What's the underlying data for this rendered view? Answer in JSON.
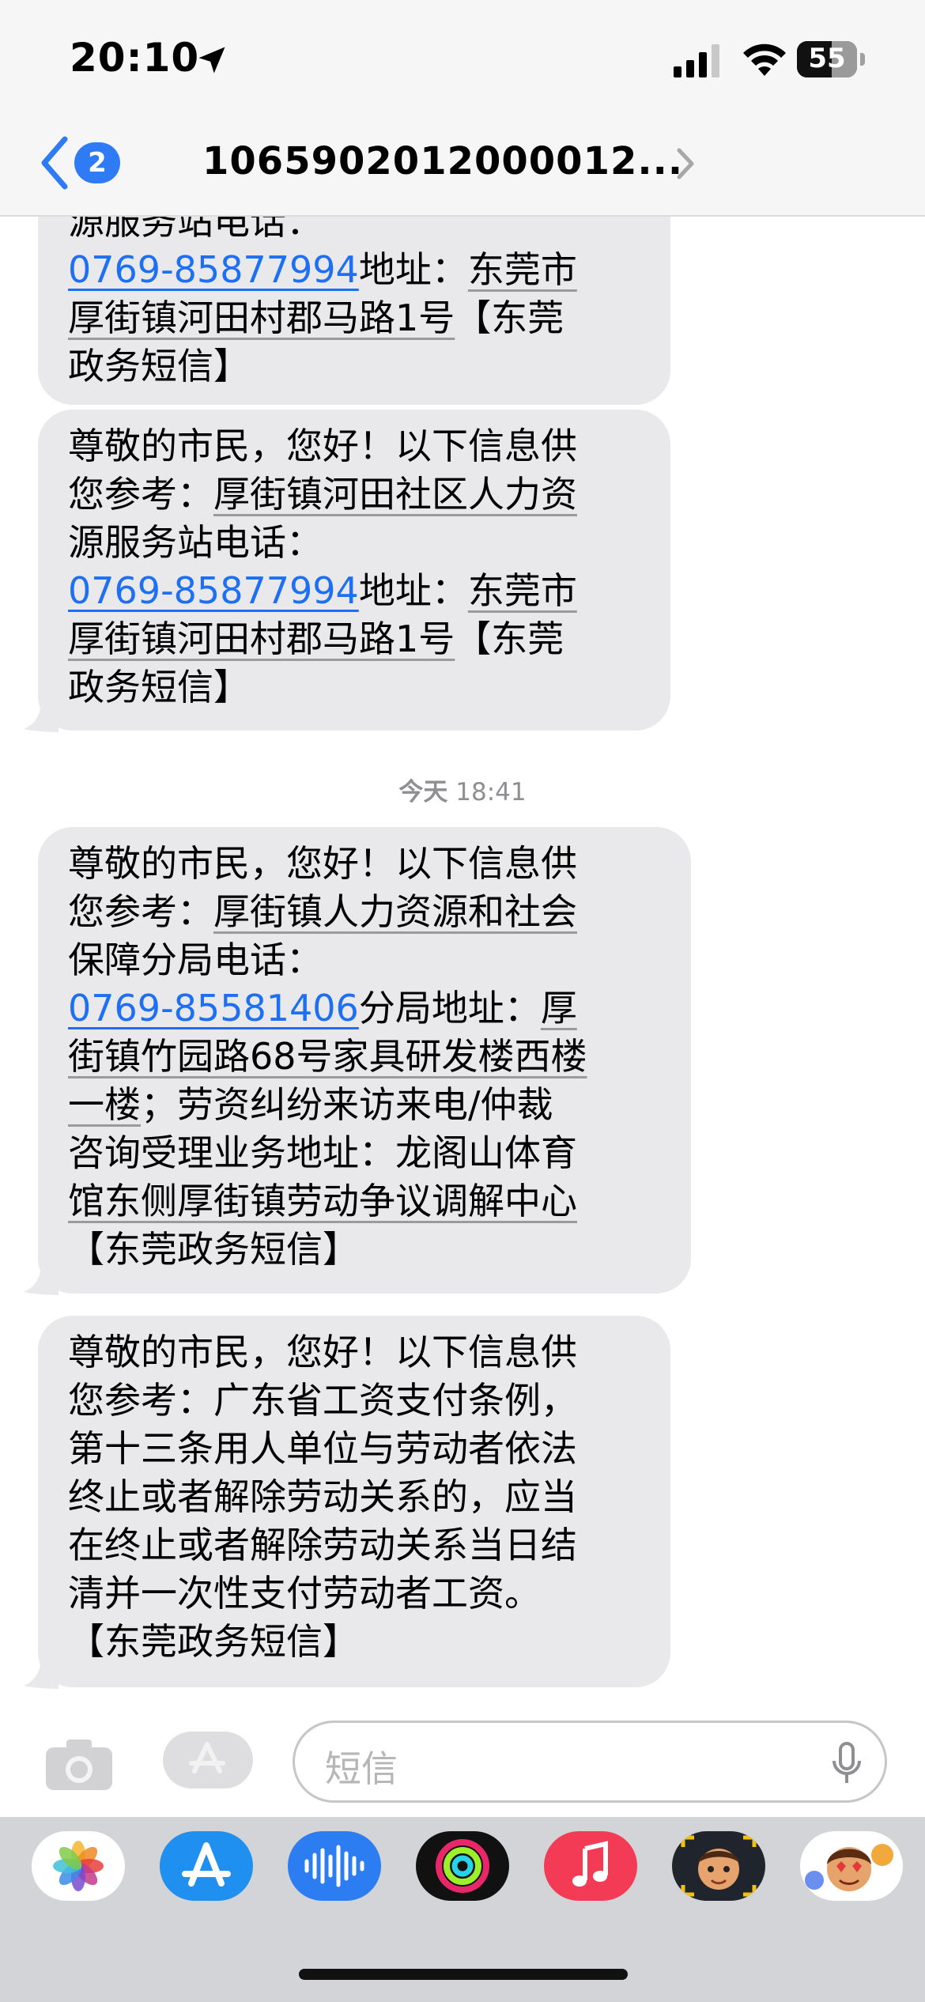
{
  "status_bar": {
    "time": "20:10",
    "battery": "55"
  },
  "header": {
    "back_badge": "2",
    "title": "1065902012000012..."
  },
  "messages": [
    {
      "lines": [
        "源服务站电话：",
        "0769-85877994",
        "地址：",
        "东莞市",
        "厚街镇河田村郡马路1号",
        "【东莞",
        "政务短信】"
      ]
    },
    {
      "lines": [
        "尊敬的市民，您好！以下信息供",
        "您参考：",
        "厚街镇河田社区人力资",
        "源服务站电话：",
        "0769-85877994",
        "地址：",
        "东莞市",
        "厚街镇河田村郡马路1号",
        "【东莞",
        "政务短信】"
      ]
    },
    {
      "lines": [
        "尊敬的市民，您好！以下信息供",
        "您参考：",
        "厚街镇人力资源和社会",
        "保障分局电话：",
        "0769-85581406",
        "分局地址：",
        "厚",
        "街镇竹园路68号家具研发楼西楼",
        "一楼",
        "；劳资纠纷来访来电/仲裁",
        "咨询受理业务地址：龙阁山体育",
        "馆东侧厚街镇劳动争议调解中心",
        "【东莞政务短信】"
      ]
    },
    {
      "lines": [
        "尊敬的市民，您好！以下信息供",
        "您参考：广东省工资支付条例，",
        "第十三条用人单位与劳动者依法",
        "终止或者解除劳动关系的，应当",
        "在终止或者解除劳动关系当日结",
        "清并一次性支付劳动者工资。",
        "【东莞政务短信】"
      ]
    }
  ],
  "timestamp": {
    "day": "今天",
    "time": "18:41"
  },
  "input": {
    "placeholder": "短信"
  },
  "app_strip": [
    "photos-icon",
    "app-store-icon",
    "audio-messages-icon",
    "activity-icon",
    "music-icon",
    "memoji-icon",
    "memoji-stickers-icon"
  ],
  "colors": {
    "bubble": "#e9e9eb",
    "link": "#1d6ff3",
    "badge": "#2f7bf5"
  }
}
